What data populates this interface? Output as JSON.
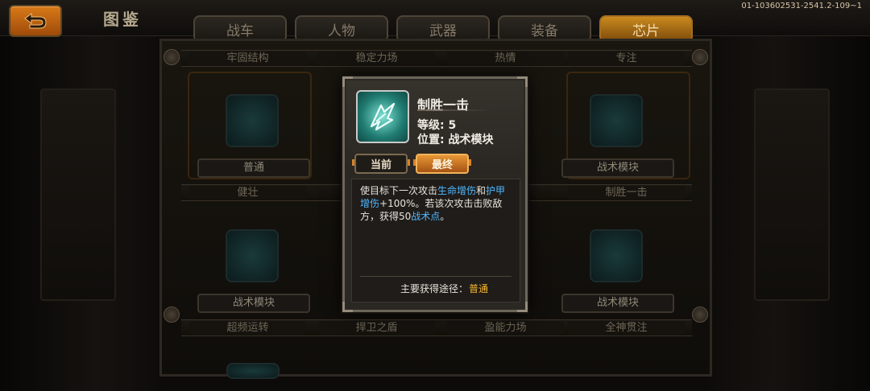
{
  "header": {
    "title": "图鉴",
    "version": "01-103602531-2541.2-109~1"
  },
  "tabs": [
    {
      "label": "战车",
      "active": false
    },
    {
      "label": "人物",
      "active": false
    },
    {
      "label": "武器",
      "active": false
    },
    {
      "label": "装备",
      "active": false
    },
    {
      "label": "芯片",
      "active": true
    }
  ],
  "grid": {
    "row1_names": [
      "牢固结构",
      "稳定力场",
      "热情",
      "专注"
    ],
    "row1_labels": [
      "普通",
      "战术模块"
    ],
    "row2_names": [
      "健壮",
      "制胜一击"
    ],
    "row2_labels": [
      "战术模块",
      "战术模块"
    ],
    "row3_names": [
      "超频运转",
      "捍卫之盾",
      "盈能力场",
      "全神贯注"
    ]
  },
  "popup": {
    "name": "制胜一击",
    "level_label": "等级: 5",
    "position_label": "位置: 战术模块",
    "btn_current": "当前",
    "btn_final": "最终",
    "desc_part1": "使目标下一次攻击",
    "desc_hl1": "生命增伤",
    "desc_part2": "和",
    "desc_hl2": "护甲增伤",
    "desc_part3": "+100%。若该次攻击击败敌方，获得50",
    "desc_hl3": "战术点",
    "desc_part4": "。",
    "source_label": "主要获得途径：",
    "source_value": "普通"
  },
  "colors": {
    "accent_orange": "#d87a18",
    "highlight_blue": "#4fb7ff",
    "source_gold": "#f5b832"
  }
}
